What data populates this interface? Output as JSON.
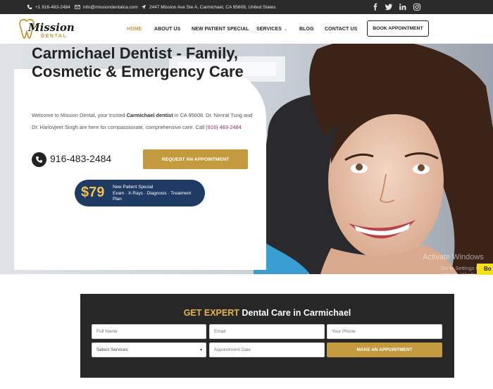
{
  "topbar": {
    "phone": "+1 916-483-2484",
    "email": "info@missiondentalca.com",
    "address": "2447 Mission Ave Ste A, Carmichael, CA 95608, United States",
    "social": [
      "facebook-icon",
      "twitter-icon",
      "linkedin-icon",
      "instagram-icon"
    ]
  },
  "logo": {
    "script": "Mission",
    "sub": "DENTAL"
  },
  "nav": {
    "items": [
      {
        "label": "HOME",
        "active": true
      },
      {
        "label": "ABOUT US"
      },
      {
        "label": "NEW PATIENT SPECIAL"
      },
      {
        "label": "SERVICES",
        "has_dropdown": true
      },
      {
        "label": "BLOG"
      },
      {
        "label": "CONTACT US"
      }
    ],
    "cta": "BOOK APPOINTMENT"
  },
  "hero": {
    "title": "Carmichael Dentist - Family, Cosmetic & Emergency Care",
    "desc_1": "Welcome to Mission Dental, your trusted ",
    "desc_bold": "Carmichael dentist",
    "desc_2": " in CA 95608. Dr. Nimrat Tung and Dr. Harlovjeet Singh are here for compassionate, comprehensive care. Call ",
    "desc_tel": "(916) 483-2484",
    "phone": "916-483-2484",
    "cta": "REQUEST AN APPOINTMENT",
    "promo": {
      "price": "$79",
      "line1": "New Patient Special",
      "line2": "Exam · X-Rays · Diagnosis · Treatment Plan"
    }
  },
  "watermark": {
    "line1": "Activate Windows",
    "line2": "Go to Settings to activate Windows.",
    "badge": "Bo"
  },
  "form": {
    "title_gold": "GET EXPERT",
    "title_rest": " Dental Care in Carmichael",
    "placeholders": {
      "name": "Full Name",
      "email": "Email",
      "phone": "Your Phone",
      "date": "Appointment Date"
    },
    "select": "Select Services",
    "submit": "MAKE AN APPOINTMENT"
  },
  "colors": {
    "gold": "#c49a3f",
    "dark": "#272727",
    "navy": "#1f3a63",
    "accent_link": "#b2274b"
  }
}
